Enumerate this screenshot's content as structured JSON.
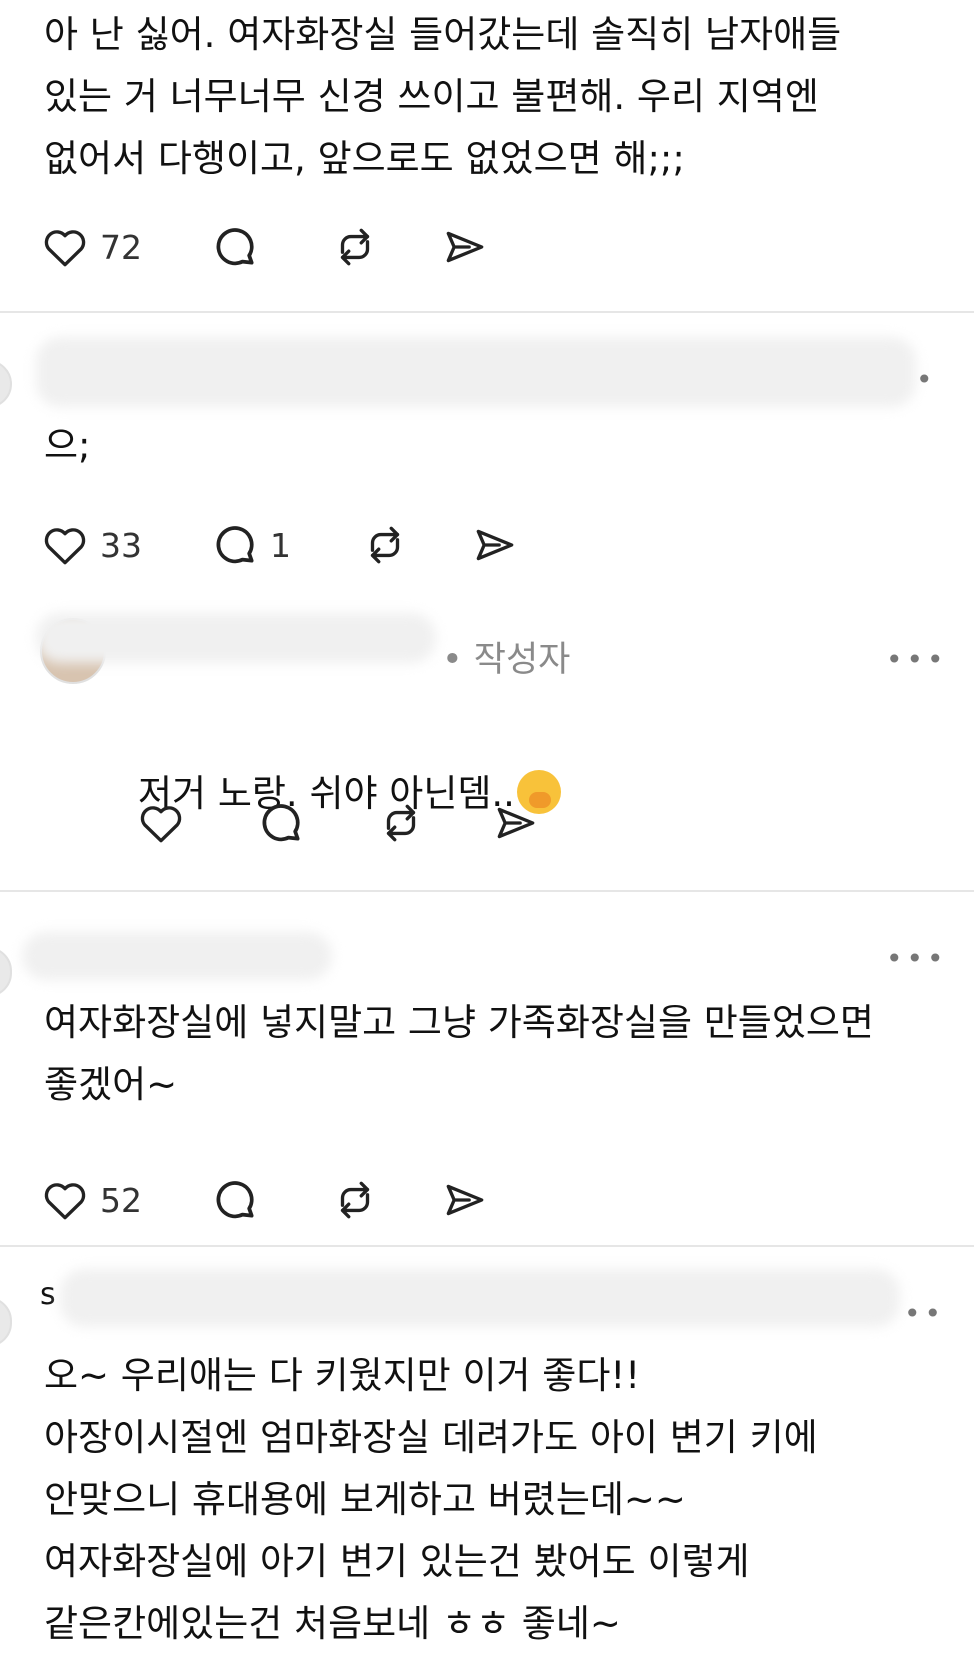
{
  "posts": [
    {
      "text": "아 난 싫어. 여자화장실 들어갔는데 솔직히 남자애들\n있는 거 너무너무 신경 쓰이고 불편해. 우리 지역엔\n없어서 다행이고, 앞으로도 없었으면 해;;;",
      "likes": "72",
      "replies": ""
    },
    {
      "text": "으;",
      "likes": "33",
      "replies": "1"
    },
    {
      "author_badge": "• 작성자",
      "text": "저거 노랑. 쉬야 아닌뎀..",
      "emoji": "hand-over-mouth-emoji",
      "likes": "",
      "replies": ""
    },
    {
      "text": "여자화장실에 넣지말고 그냥 가족화장실을 만들었으면\n좋겠어~",
      "likes": "52",
      "replies": ""
    },
    {
      "author_initial": "s",
      "text": "오~ 우리애는 다 키웠지만 이거 좋다!!\n아장이시절엔 엄마화장실 데려가도 아이 변기 키에\n안맞으니 휴대용에 보게하고 버렸는데~~\n여자화장실에 아기 변기 있는건 봤어도 이렇게\n같은칸에있는건 처음보네 ㅎㅎ 좋네~"
    }
  ],
  "more_label": "•••",
  "icons": {
    "like": "heart-icon",
    "reply": "comment-bubble-icon",
    "repost": "repost-icon",
    "share": "send-icon"
  },
  "colors": {
    "divider": "#e6e6e6",
    "icon": "#222222",
    "muted": "#8a8a8a"
  }
}
